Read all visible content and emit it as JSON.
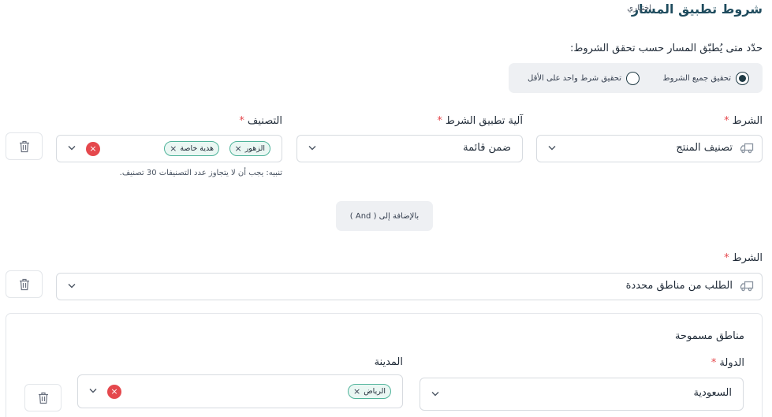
{
  "header": {
    "title": "شروط تطبيق المسار",
    "optional_label": "اختياري"
  },
  "question": "حدّد متى يُطبّق المسار حسب تحقق الشروط:",
  "match_mode": {
    "options": [
      {
        "label": "تحقيق جميع الشروط",
        "selected": true
      },
      {
        "label": "تحقيق شرط واحد على الأقل",
        "selected": false
      }
    ]
  },
  "condition1": {
    "condition_label": "الشرط",
    "condition_value": "تصنيف المنتج",
    "mechanism_label": "آلية تطبيق الشرط",
    "mechanism_value": "ضمن قائمة",
    "category_label": "التصنيف",
    "tags": [
      "الزهور",
      "هدية خاصة"
    ],
    "hint": "تنبيه: يجب أن لا يتجاوز عدد التصنيفات 30 تصنيف."
  },
  "and_button": "بالإضافة إلى ( And )",
  "condition2": {
    "condition_label": "الشرط",
    "condition_value": "الطلب من مناطق محددة",
    "panel": {
      "title": "مناطق مسموحة",
      "country_label": "الدولة",
      "country_value": "السعودية",
      "city_label": "المدينة",
      "city_tags": [
        "الرياض"
      ]
    }
  },
  "colors": {
    "required": "#e5484d",
    "tag_border": "#4fb39a",
    "tag_bg": "#eaf7f3",
    "title": "#1f4c5e"
  }
}
